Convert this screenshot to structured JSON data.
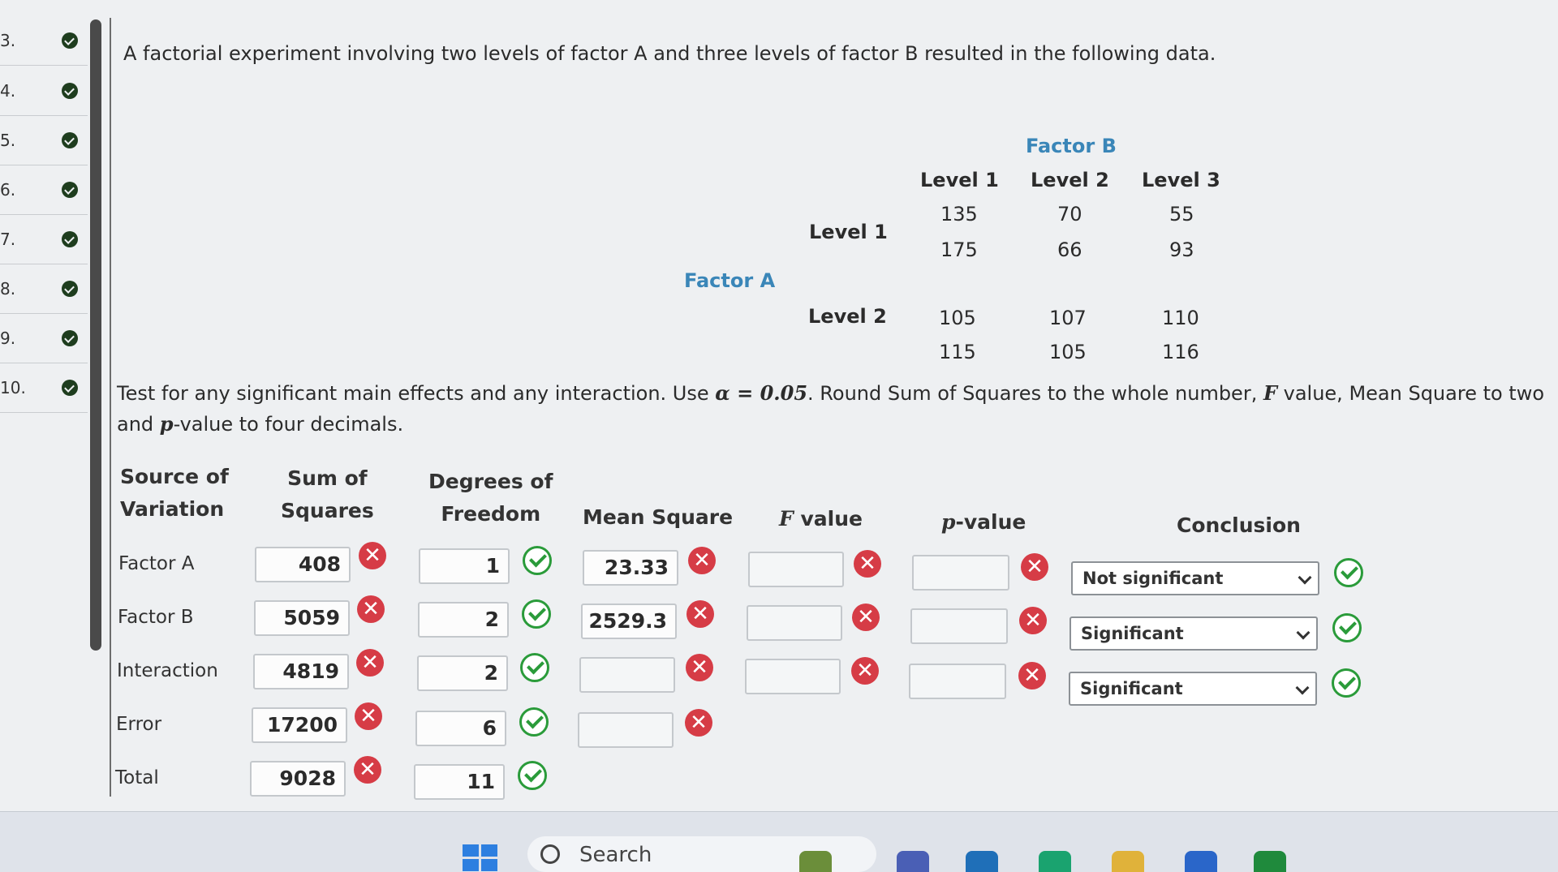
{
  "rail": {
    "items": [
      {
        "num": "3."
      },
      {
        "num": "4."
      },
      {
        "num": "5."
      },
      {
        "num": "6."
      },
      {
        "num": "7."
      },
      {
        "num": "8."
      },
      {
        "num": "9."
      },
      {
        "num": "10."
      }
    ]
  },
  "problem": "A factorial experiment involving two levels of factor A and three levels of factor B resulted in the following data.",
  "data_table": {
    "factor_b_label": "Factor B",
    "factor_a_label": "Factor A",
    "col_headers": [
      "Level 1",
      "Level 2",
      "Level 3"
    ],
    "row_headers": [
      "Level 1",
      "Level 2"
    ],
    "cells": [
      [
        "135",
        "70",
        "55"
      ],
      [
        "175",
        "66",
        "93"
      ],
      [
        "105",
        "107",
        "110"
      ],
      [
        "115",
        "105",
        "116"
      ]
    ]
  },
  "instructions": {
    "part1": "Test for any significant main effects and any interaction. Use ",
    "alpha": "α = 0.05",
    "part2": ". Round Sum of Squares to the whole number, ",
    "f": "F",
    "part3": " value, Mean Square to two",
    "part4": "and ",
    "p": "p",
    "part5": "-value to four decimals."
  },
  "anova": {
    "headers": {
      "source_1": "Source of",
      "source_2": "Variation",
      "ss_1": "Sum of",
      "ss_2": "Squares",
      "df_1": "Degrees of",
      "df_2": "Freedom",
      "ms": "Mean Square",
      "f_italic": "F",
      "f_rest": " value",
      "p_italic": "p",
      "p_rest": "-value",
      "conclusion": "Conclusion"
    },
    "rows": [
      {
        "label": "Factor A",
        "ss": "408",
        "df": "1",
        "ms": "23.33",
        "f": "",
        "p": "",
        "conclusion": "Not significant"
      },
      {
        "label": "Factor B",
        "ss": "5059",
        "df": "2",
        "ms": "2529.3",
        "f": "",
        "p": "",
        "conclusion": "Significant"
      },
      {
        "label": "Interaction",
        "ss": "4819",
        "df": "2",
        "ms": "",
        "f": "",
        "p": "",
        "conclusion": "Significant"
      },
      {
        "label": "Error",
        "ss": "17200",
        "df": "6",
        "ms": ""
      },
      {
        "label": "Total",
        "ss": "9028",
        "df": "11"
      }
    ]
  },
  "taskbar": {
    "search_label": "Search"
  }
}
